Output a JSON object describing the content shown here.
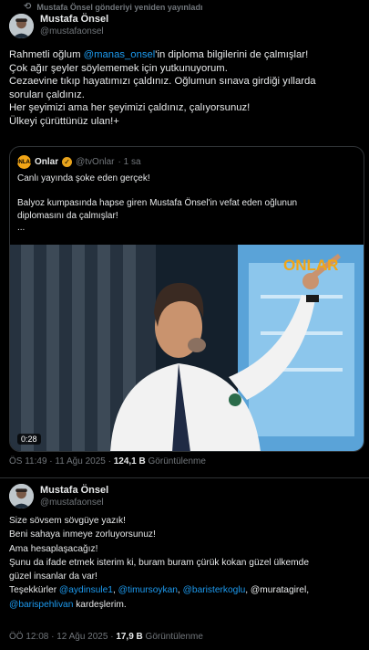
{
  "repost_label": "Mustafa Önsel gönderiyi yeniden yayınladı",
  "tweet1": {
    "name": "Mustafa Önsel",
    "handle": "@mustafaonsel",
    "lines": [
      {
        "pre": "Rahmetli oğlum ",
        "link": "@manas_onsel",
        "post": "'in diploma bilgilerini de çalmışlar!"
      },
      {
        "pre": "Çok ağır şeyler söylememek için yutkunuyorum.",
        "link": "",
        "post": ""
      },
      {
        "pre": "Cezaevine tıkıp hayatımızı çaldınız. Oğlumun sınava girdiği yıllarda",
        "link": "",
        "post": ""
      },
      {
        "pre": "soruları çaldınız.",
        "link": "",
        "post": ""
      },
      {
        "pre": "Her şeyimizi ama her şeyimizi çaldınız, çalıyorsunuz!",
        "link": "",
        "post": ""
      },
      {
        "pre": "Ülkeyi çürüttünüz ulan!+",
        "link": "",
        "post": ""
      }
    ],
    "quote": {
      "logo_text": "ONLAR",
      "name": "Onlar",
      "handle": "@tvOnlar",
      "time": "· 1 sa",
      "lines": [
        "Canlı yayında şoke eden gerçek!",
        "",
        "Balyoz kumpasında hapse giren Mustafa Önsel'in vefat eden oğlunun",
        "diplomasını da çalmışlar!",
        "..."
      ],
      "video_duration": "0:28",
      "video_watermark": "ONLAR"
    },
    "meta_time": "ÖS 11:49 · 11 Ağu 2025 · ",
    "views": "124,1 B",
    "views_label": " Görüntülenme"
  },
  "tweet2": {
    "name": "Mustafa Önsel",
    "handle": "@mustafaonsel",
    "lines": [
      [
        {
          "t": "Size sövsem sövgüye yazık!",
          "l": false
        }
      ],
      [
        {
          "t": "Beni sahaya inmeye zorluyorsunuz!",
          "l": false
        }
      ],
      [
        {
          "t": "Ama hesaplaşacağız!",
          "l": false
        }
      ],
      [
        {
          "t": "Şunu da ifade etmek isterim ki, buram buram çürük kokan güzel ülkemde",
          "l": false
        }
      ],
      [
        {
          "t": "güzel insanlar da var!",
          "l": false
        }
      ],
      [
        {
          "t": "Teşekkürler ",
          "l": false
        },
        {
          "t": "@aydinsule1",
          "l": true
        },
        {
          "t": ", ",
          "l": false
        },
        {
          "t": "@timursoykan",
          "l": true
        },
        {
          "t": ", ",
          "l": false
        },
        {
          "t": "@baristerkoglu",
          "l": true
        },
        {
          "t": ", @muratagirel,",
          "l": false
        }
      ],
      [
        {
          "t": "@barispehlivan",
          "l": true
        },
        {
          "t": " kardeşlerim.",
          "l": false
        }
      ]
    ],
    "meta_time": "ÖÖ 12:08 · 12 Ağu 2025 · ",
    "views": "17,9 B",
    "views_label": " Görüntülenme"
  }
}
